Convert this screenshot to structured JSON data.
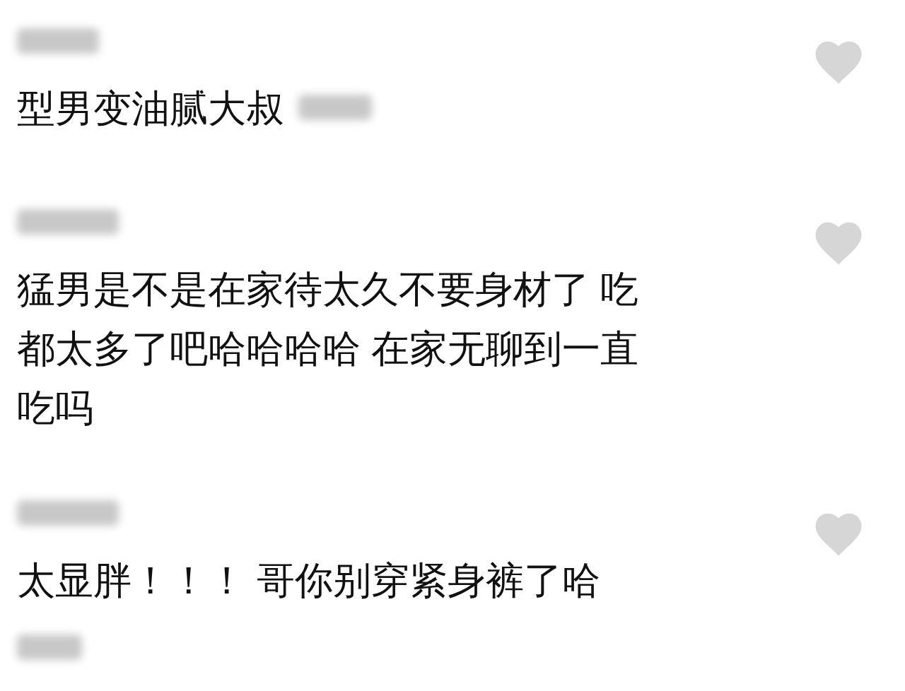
{
  "comments": [
    {
      "text": "型男变油腻大叔"
    },
    {
      "text": "猛男是不是在家待太久不要身材了 吃都太多了吧哈哈哈哈 在家无聊到一直吃吗"
    },
    {
      "text": "太显胖！！！ 哥你别穿紧身裤了哈"
    }
  ]
}
